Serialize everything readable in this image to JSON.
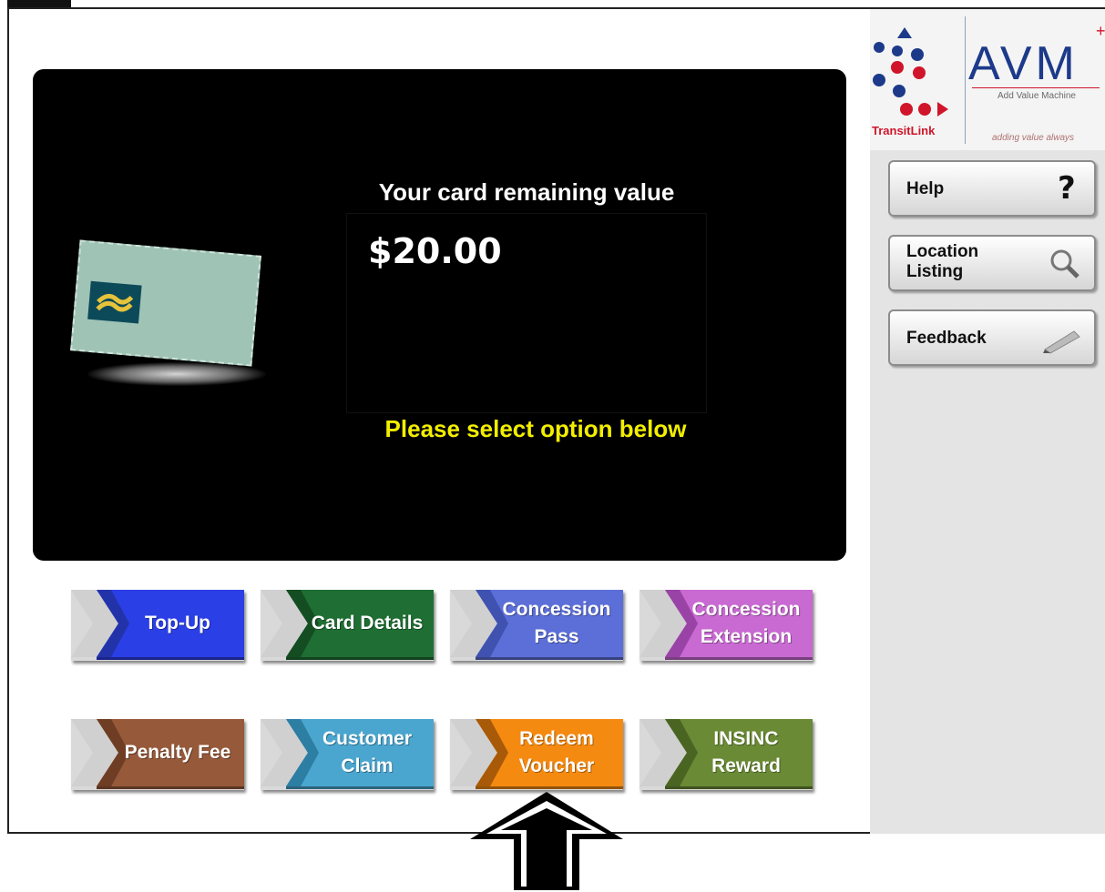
{
  "branding": {
    "transitlink": "TransitLink",
    "avm": "AVM",
    "avm_plus": "+",
    "avm_subtitle": "Add Value Machine",
    "avm_tagline": "adding value always"
  },
  "sidebar": {
    "help_label": "Help",
    "location_label_line1": "Location",
    "location_label_line2": "Listing",
    "feedback_label": "Feedback"
  },
  "display": {
    "title": "Your card remaining value",
    "amount": "$20.00",
    "instruction": "Please select option below"
  },
  "options": {
    "topup": {
      "line1": "Top-Up",
      "line2": "",
      "color": "#2b3fe6"
    },
    "card_details": {
      "line1": "Card Details",
      "line2": "",
      "color": "#1f6e33"
    },
    "concession_pass": {
      "line1": "Concession",
      "line2": "Pass",
      "color": "#5c6fd8"
    },
    "concession_extension": {
      "line1": "Concession",
      "line2": "Extension",
      "color": "#c86ad2"
    },
    "penalty_fee": {
      "line1": "Penalty Fee",
      "line2": "",
      "color": "#96593a"
    },
    "customer_claim": {
      "line1": "Customer",
      "line2": "Claim",
      "color": "#4aa6cf"
    },
    "redeem_voucher": {
      "line1": "Redeem",
      "line2": "Voucher",
      "color": "#f58a10"
    },
    "insinc_reward": {
      "line1": "INSINC",
      "line2": "Reward",
      "color": "#6a8a35"
    }
  },
  "colors": {
    "screen_bg": "#000000",
    "instruction_text": "#f2ee00",
    "sidebar_bg": "#e4e4e4"
  },
  "icons": [
    "question-mark-icon",
    "magnifier-icon",
    "pen-icon",
    "chevron-icon",
    "up-arrow-icon"
  ]
}
